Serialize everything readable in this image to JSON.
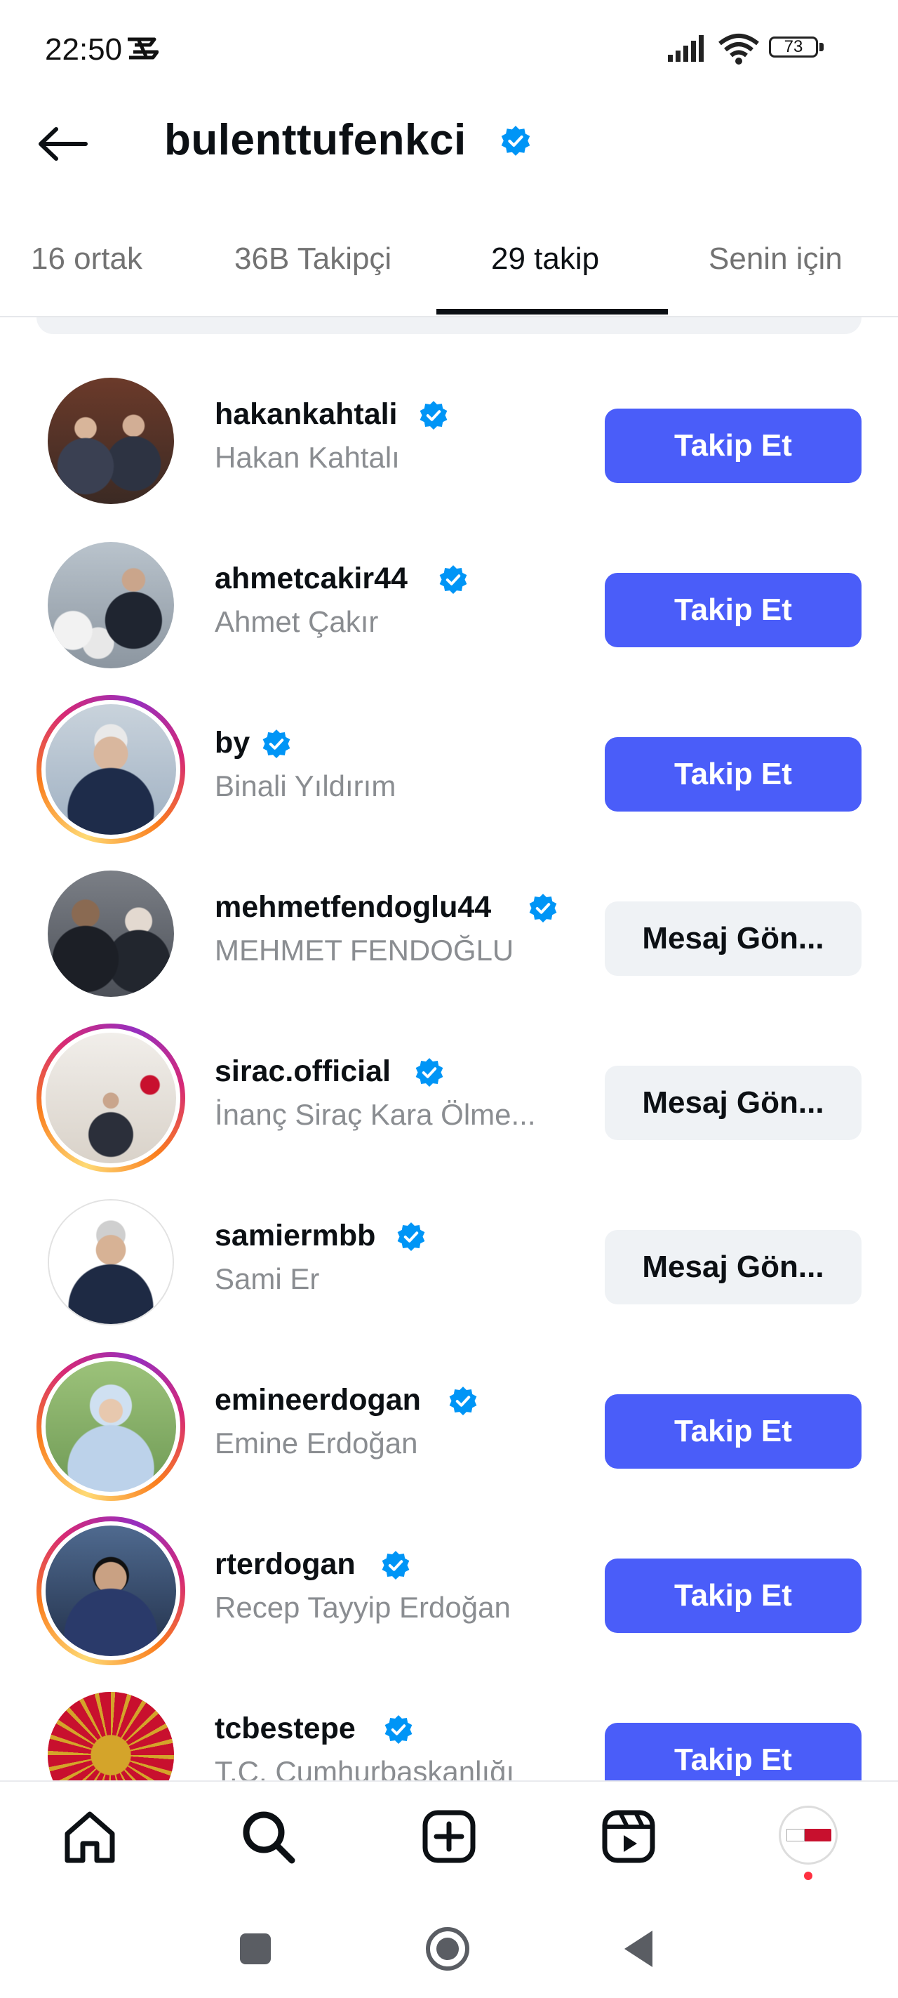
{
  "status_bar": {
    "time": "22:50",
    "battery": "73"
  },
  "header": {
    "title": "bulenttufenkci",
    "verified": true
  },
  "tabs": [
    {
      "label": "16 ortak",
      "active": false
    },
    {
      "label": "36B Takipçi",
      "active": false
    },
    {
      "label": "29 takip",
      "active": true
    },
    {
      "label": "Senin için",
      "active": false
    }
  ],
  "following": [
    {
      "username": "hakankahtali",
      "full_name": "Hakan Kahtalı",
      "button": "Takip Et",
      "button_type": "follow",
      "story_ring": false
    },
    {
      "username": "ahmetcakir44",
      "full_name": "Ahmet Çakır",
      "button": "Takip Et",
      "button_type": "follow",
      "story_ring": false
    },
    {
      "username": "by",
      "full_name": "Binali Yıldırım",
      "button": "Takip Et",
      "button_type": "follow",
      "story_ring": true
    },
    {
      "username": "mehmetfendoglu44",
      "full_name": "MEHMET FENDOĞLU",
      "button": "Mesaj Gön...",
      "button_type": "message",
      "story_ring": false
    },
    {
      "username": "sirac.official",
      "full_name": "İnanç Siraç Kara Ölme...",
      "button": "Mesaj Gön...",
      "button_type": "message",
      "story_ring": true
    },
    {
      "username": "samiermbb",
      "full_name": "Sami Er",
      "button": "Mesaj Gön...",
      "button_type": "message",
      "story_ring": false
    },
    {
      "username": "emineerdogan",
      "full_name": "Emine Erdoğan",
      "button": "Takip Et",
      "button_type": "follow",
      "story_ring": true
    },
    {
      "username": "rterdogan",
      "full_name": "Recep Tayyip Erdoğan",
      "button": "Takip Et",
      "button_type": "follow",
      "story_ring": true
    },
    {
      "username": "tcbestepe",
      "full_name": "T.C. Cumhurbaşkanlığı",
      "button": "Takip Et",
      "button_type": "follow",
      "story_ring": false
    }
  ],
  "colors": {
    "follow_button": "#4a5df9",
    "message_button": "#eff2f5",
    "verified": "#0095f6",
    "notification_dot": "#ff3040"
  },
  "bottom_nav": [
    "home-icon",
    "search-icon",
    "create-icon",
    "reels-icon",
    "profile-avatar"
  ],
  "system_nav": [
    "recents-icon",
    "home-circle-icon",
    "back-triangle-icon"
  ]
}
